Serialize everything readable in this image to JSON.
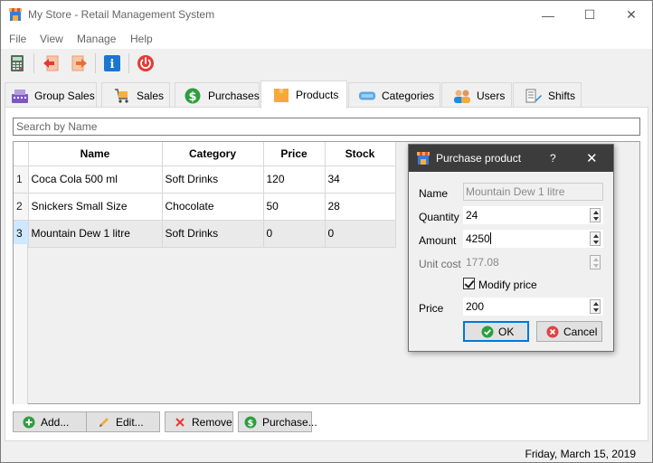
{
  "window": {
    "title": "My Store - Retail Management System",
    "controls": {
      "minimize": "—",
      "maximize": "☐",
      "close": "✕"
    }
  },
  "menu": [
    "File",
    "View",
    "Manage",
    "Help"
  ],
  "toolbar": {
    "icons": [
      "calculator-icon",
      "back-icon",
      "forward-icon",
      "info-icon",
      "power-icon"
    ],
    "info_glyph": "i"
  },
  "tabs": [
    {
      "label": "Group Sales",
      "icon": "register-icon"
    },
    {
      "label": "Sales",
      "icon": "cart-icon"
    },
    {
      "label": "Purchases",
      "icon": "dollar-icon"
    },
    {
      "label": "Products",
      "icon": "box-icon",
      "active": true
    },
    {
      "label": "Categories",
      "icon": "tag-icon"
    },
    {
      "label": "Users",
      "icon": "users-icon"
    },
    {
      "label": "Shifts",
      "icon": "shifts-icon"
    }
  ],
  "search": {
    "placeholder": "Search by Name"
  },
  "table": {
    "columns": [
      "Name",
      "Category",
      "Price",
      "Stock"
    ],
    "rows": [
      {
        "num": "1",
        "name": "Coca Cola 500 ml",
        "category": "Soft Drinks",
        "price": "120",
        "stock": "34"
      },
      {
        "num": "2",
        "name": "Snickers Small Size",
        "category": "Chocolate",
        "price": "50",
        "stock": "28"
      },
      {
        "num": "3",
        "name": "Mountain Dew 1 litre",
        "category": "Soft Drinks",
        "price": "0",
        "stock": "0",
        "selected": true
      }
    ]
  },
  "buttons": {
    "add": "Add...",
    "edit": "Edit...",
    "remove": "Remove",
    "purchase": "Purchase..."
  },
  "status": {
    "date": "Friday, March 15, 2019"
  },
  "dialog": {
    "title": "Purchase product",
    "help": "?",
    "close": "✕",
    "fields": {
      "name_label": "Name",
      "name_value": "Mountain Dew 1 litre",
      "quantity_label": "Quantity",
      "quantity_value": "24",
      "amount_label": "Amount",
      "amount_value": "4250",
      "unit_cost_label": "Unit cost",
      "unit_cost_value": "177.08",
      "modify_price_label": "Modify price",
      "modify_price_checked": true,
      "price_label": "Price",
      "price_value": "200"
    },
    "ok": "OK",
    "cancel": "Cancel"
  },
  "colors": {
    "accent": "#0078d7",
    "dialog_title_bg": "#3c3c3c",
    "selected_row": "#cde8ff",
    "ok_green": "#2e9e3e",
    "cancel_red": "#e04343"
  }
}
